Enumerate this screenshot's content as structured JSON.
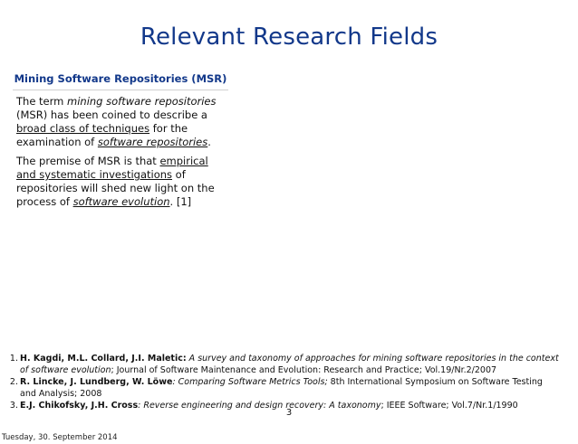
{
  "slide": {
    "title": "Relevant Research Fields",
    "page_number": "3",
    "footer_date": "Tuesday, 30. September 2014"
  },
  "box": {
    "title": "Mining Software Repositories (MSR)",
    "p1": {
      "a": "The term ",
      "b": "mining software repositories",
      "c": " (MSR) has been coined to describe a ",
      "d": "broad class of techniques",
      "e": " for the examination of ",
      "f": "software repositories",
      "g": "."
    },
    "p2": {
      "a": "The premise of MSR is that ",
      "b": "empirical and systematic investigations",
      "c": " of repositories will shed new light on the process of ",
      "d": "software evolution",
      "e": ". [1]"
    }
  },
  "references": [
    {
      "num": "1.",
      "authors": "H. Kagdi, M.L. Collard, J.I. Maletic:",
      "title": " A survey and taxonomy of approaches for mining software repositories in the context of software evolution",
      "rest": "; Journal of Software Maintenance and Evolution: Research and Practice; Vol.19/Nr.2/2007"
    },
    {
      "num": "2.",
      "authors": "R. Lincke, J. Lundberg, W. Löwe",
      "title": ": Comparing Software Metrics Tools;",
      "rest": " 8th International Symposium on Software Testing and Analysis; 2008"
    },
    {
      "num": "3.",
      "authors": "E.J. Chikofsky, J.H. Cross",
      "title": ": Reverse engineering and design recovery: A taxonomy",
      "rest": "; IEEE Software; Vol.7/Nr.1/1990"
    }
  ]
}
